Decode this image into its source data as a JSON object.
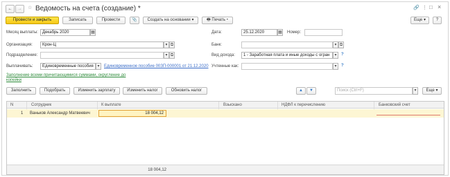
{
  "title": "Ведомость на счета (создание) *",
  "nav": {
    "back": "←",
    "forward": "→",
    "star": "☆"
  },
  "window_controls": {
    "link": "🔗",
    "menu": "⋮",
    "maximize": "□",
    "close": "×"
  },
  "toolbar": {
    "post_close": "Провести и закрыть",
    "write": "Записать",
    "post": "Провести",
    "attach": "📎",
    "create_based": "Создать на основании",
    "print": "Печать",
    "more": "Еще",
    "help": "?"
  },
  "form": {
    "month_label": "Месяц выплаты:",
    "month_value": "Декабрь 2020",
    "org_label": "Организация:",
    "org_value": "Крон-Ц",
    "dept_label": "Подразделение:",
    "dept_value": "",
    "pay_label": "Выплачивать:",
    "pay_value": "Единовременные пособия",
    "pay_link": "Единовременное пособие 00ЗП-000001 от 21.12.2020",
    "date_label": "Дата:",
    "date_value": "25.12.2020",
    "number_label": "Номер:",
    "number_value": "",
    "bank_label": "Банк:",
    "bank_value": "",
    "income_label": "Вид дохода:",
    "income_value": "1 - Заработная плата и иные доходы с огран",
    "accounted_label": "Учтенные как:",
    "accounted_value": "",
    "fill_link": "Заполнение всеми причитающимися суммами, округление до копейки"
  },
  "table_toolbar": {
    "fill": "Заполнить",
    "select": "Подобрать",
    "change_salary": "Изменить зарплату",
    "change_tax": "Изменить налог",
    "update_tax": "Обновить налог",
    "search_placeholder": "Поиск (Ctrl+F)",
    "more": "Еще"
  },
  "table": {
    "columns": [
      "N",
      "Сотрудник",
      "К выплате",
      "Взыскано",
      "НДФЛ к перечислению",
      "Банковский счет"
    ],
    "rows": [
      {
        "n": "1",
        "employee": "Ваньков Александр Матвеевич",
        "to_pay": "18 004,12",
        "withheld": "",
        "ndfl": "",
        "account": ""
      }
    ],
    "total_to_pay": "18 004,12"
  }
}
